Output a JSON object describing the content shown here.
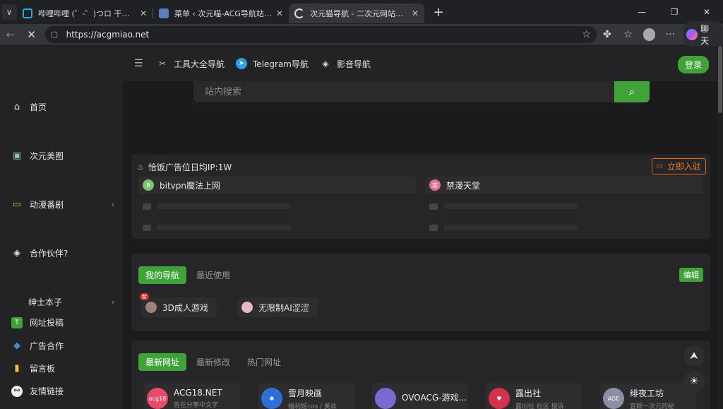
{
  "browser": {
    "tabs": [
      {
        "label": "哔哩哔哩 (゜-゜)つロ 干杯~-bilibili",
        "favicon_color": "#23ade5",
        "active": false
      },
      {
        "label": "菜单 ‹ 次元喵-ACG导航站 — Word",
        "favicon_color": "#5b7fbf",
        "active": false
      },
      {
        "label": "次元猫导航 - 二次元网站分享喵",
        "favicon_color": "#ffffff",
        "active": true
      }
    ],
    "url": "https://acgmiao.net",
    "chat_label": "聊天"
  },
  "topnav": {
    "links": [
      {
        "label": "工具大全导航",
        "icon": "tools-icon"
      },
      {
        "label": "Telegram导航",
        "icon": "telegram-icon"
      },
      {
        "label": "影音导航",
        "icon": "layers-icon"
      }
    ],
    "login_label": "登录"
  },
  "sidebar": {
    "items": [
      {
        "label": "首页",
        "icon": "home-icon"
      },
      {
        "label": "次元美图",
        "icon": "image-icon"
      },
      {
        "label": "动漫番剧",
        "icon": "tv-icon"
      },
      {
        "label": "合作伙伴?",
        "icon": "layers-icon"
      },
      {
        "label": "绅士本子",
        "icon": ""
      },
      {
        "label": "网址投稿",
        "icon": "submit-icon"
      },
      {
        "label": "广告合作",
        "icon": "diamond-icon"
      },
      {
        "label": "留言板",
        "icon": "message-icon"
      },
      {
        "label": "友情链接",
        "icon": "link-icon"
      }
    ]
  },
  "search": {
    "placeholder": "站内搜索"
  },
  "ad": {
    "title": "恰饭广告位日均IP:1W",
    "join_label": "立即入驻",
    "items": [
      {
        "label": "bitvpn魔法上网",
        "color": "#7ac26b",
        "initial": "B"
      },
      {
        "label": "禁漫天堂",
        "color": "#e0708f",
        "initial": "禁"
      }
    ]
  },
  "mynav": {
    "tabs": [
      "我的导航",
      "最近使用"
    ],
    "edit_label": "编辑",
    "items": [
      {
        "label": "3D成人游戏",
        "badge": "新"
      },
      {
        "label": "无限制AI涩涩",
        "badge": ""
      }
    ]
  },
  "latest": {
    "tabs": [
      "最新网址",
      "最新修改",
      "热门网址"
    ],
    "sites": [
      {
        "name": "ACG18.NET",
        "desc": "旨在分享中文字",
        "logo_text": "acg18",
        "color": "#e84a6a"
      },
      {
        "name": "雪月映画",
        "desc": "福利姬cos / 美丝",
        "logo_text": "",
        "color": "#2c6fd6"
      },
      {
        "name": "OVOACG-游戏...",
        "desc": "",
        "logo_text": "",
        "color": "#7a6ad0"
      },
      {
        "name": "露出社",
        "desc": "露出社 社区 授诉",
        "logo_text": "",
        "color": "#d6304f"
      },
      {
        "name": "绯夜工坊",
        "desc": "宣颗一次元的秘",
        "logo_text": "AGE",
        "color": "#8c8fa3"
      }
    ]
  }
}
